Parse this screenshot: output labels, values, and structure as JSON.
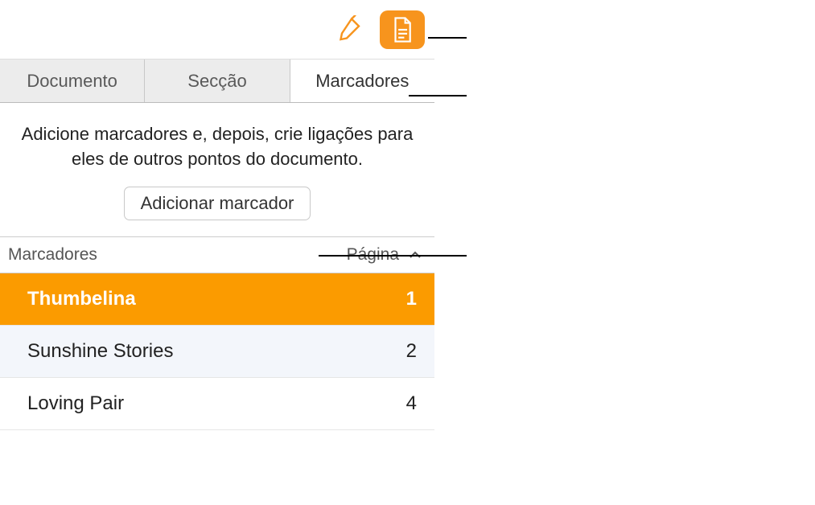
{
  "toolbar": {
    "brush_icon": "format-brush-icon",
    "doc_icon": "document-icon"
  },
  "tabs": {
    "items": [
      {
        "label": "Documento",
        "active": false
      },
      {
        "label": "Secção",
        "active": false
      },
      {
        "label": "Marcadores",
        "active": true
      }
    ]
  },
  "info": {
    "text": "Adicione marcadores e, depois, crie ligações para eles de outros pontos do documento.",
    "add_button": "Adicionar marcador"
  },
  "list_header": {
    "name_col": "Marcadores",
    "page_col": "Página"
  },
  "bookmarks": [
    {
      "name": "Thumbelina",
      "page": "1",
      "selected": true
    },
    {
      "name": "Sunshine Stories",
      "page": "2",
      "selected": false
    },
    {
      "name": "Loving Pair",
      "page": "4",
      "selected": false
    }
  ]
}
